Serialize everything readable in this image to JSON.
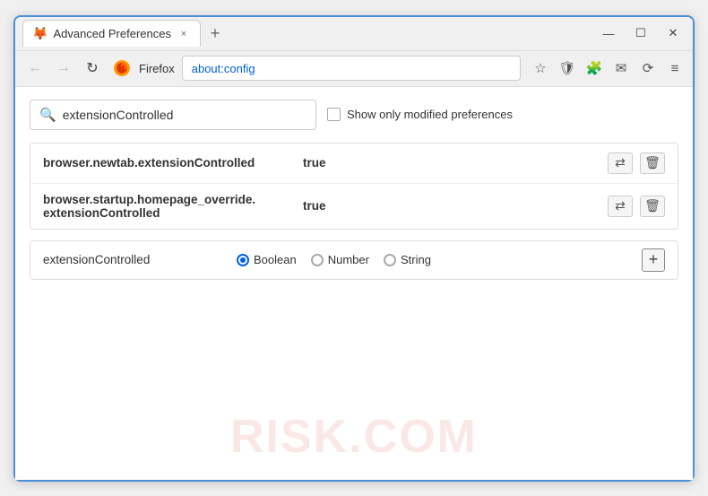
{
  "window": {
    "title": "Advanced Preferences",
    "tab_close_label": "×",
    "tab_new_label": "+",
    "win_minimize": "—",
    "win_restore": "☐",
    "win_close": "✕"
  },
  "nav": {
    "back_label": "←",
    "forward_label": "→",
    "reload_label": "↻",
    "brand": "Firefox",
    "address": "about:config",
    "star_icon": "☆",
    "shield_icon": "🛡",
    "ext_icon": "🧩",
    "mail_icon": "✉",
    "sync_icon": "⟳",
    "menu_icon": "≡"
  },
  "search": {
    "placeholder": "extensionControlled",
    "value": "extensionControlled",
    "show_modified_label": "Show only modified preferences"
  },
  "results": [
    {
      "name": "browser.newtab.extensionControlled",
      "value": "true",
      "reset_label": "⇄",
      "delete_label": "🗑"
    },
    {
      "name": "browser.startup.homepage_override.\nextensionControlled",
      "name_line1": "browser.startup.homepage_override.",
      "name_line2": "extensionControlled",
      "value": "true",
      "reset_label": "⇄",
      "delete_label": "🗑"
    }
  ],
  "add_row": {
    "name": "extensionControlled",
    "type_boolean": "Boolean",
    "type_number": "Number",
    "type_string": "String",
    "selected_type": "boolean",
    "plus_label": "+"
  },
  "watermark": "RISK.COM"
}
